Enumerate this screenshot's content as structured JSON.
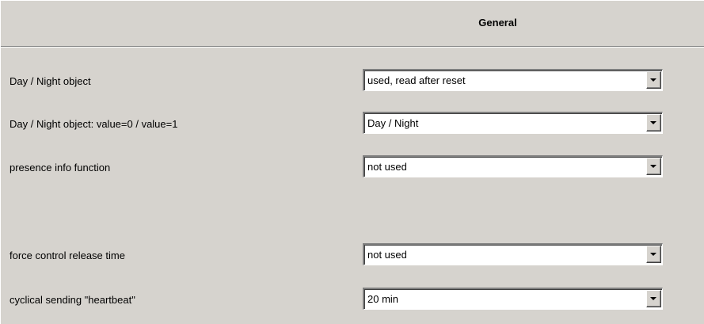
{
  "header": {
    "title": "General"
  },
  "rows": [
    {
      "label": "Day / Night object",
      "value": "used, read after reset"
    },
    {
      "label": "Day / Night object: value=0 / value=1",
      "value": "Day / Night"
    },
    {
      "label": "presence info function",
      "value": "not used"
    },
    {
      "label": "force control release time",
      "value": "not used"
    },
    {
      "label": "cyclical sending \"heartbeat\"",
      "value": "20 min"
    }
  ],
  "icons": {
    "dropdown": "chevron-down-icon"
  },
  "colors": {
    "panel_background": "#d6d3ce",
    "field_background": "#ffffff",
    "text": "#000000"
  }
}
